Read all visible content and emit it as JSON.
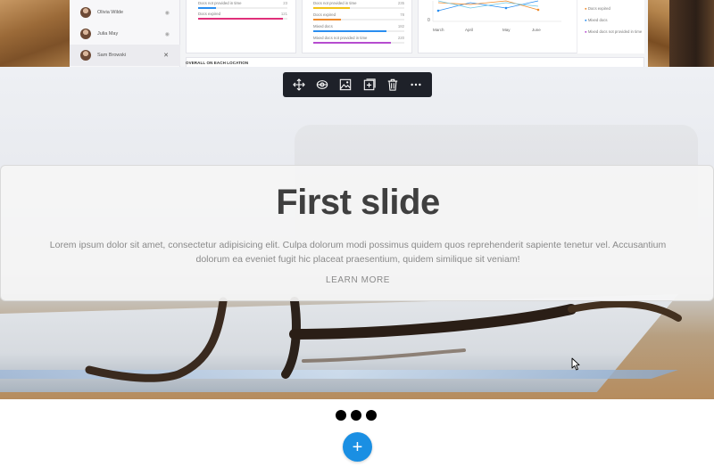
{
  "dashboard": {
    "users": [
      {
        "name": "Olivia Wilde",
        "action": "eye-icon"
      },
      {
        "name": "Julia May",
        "action": "eye-icon"
      },
      {
        "name": "Sam Browski",
        "action": "close-icon"
      }
    ],
    "card1": {
      "rows": [
        {
          "label": "Docs not provided in time",
          "value": "23",
          "fill": 0.2,
          "color": "#2a8ef0"
        },
        {
          "label": "Docs expired",
          "value": "121",
          "fill": 0.95,
          "color": "#e0307a"
        }
      ]
    },
    "card2": {
      "rows": [
        {
          "label": "Docs not provided in time",
          "value": "235",
          "fill": 0.4,
          "color": "#f2c318"
        },
        {
          "label": "Docs expired",
          "value": "78",
          "fill": 0.3,
          "color": "#f08a2a"
        },
        {
          "label": "Mixed docs",
          "value": "182",
          "fill": 0.8,
          "color": "#2a8ef0"
        },
        {
          "label": "Mixed docs not provided in time",
          "value": "220",
          "fill": 0.85,
          "color": "#b64ccf"
        }
      ]
    },
    "chart": {
      "y_tick": "0",
      "months": [
        "March",
        "April",
        "May",
        "June"
      ]
    },
    "legend": [
      {
        "label": "Docs expired",
        "color": "#f08a2a"
      },
      {
        "label": "Mixed docs",
        "color": "#2a8ef0"
      },
      {
        "label": "Mixed docs not provided in time",
        "color": "#b64ccf"
      }
    ],
    "section_title": "OVERALL ON EACH LOCATION"
  },
  "slide": {
    "title": "First slide",
    "body": "Lorem ipsum dolor sit amet, consectetur adipisicing elit. Culpa dolorum modi possimus quidem quos reprehenderit sapiente tenetur vel. Accusantium dolorum ea eveniet fugit hic placeat praesentium, quidem similique sit veniam!",
    "link": "LEARN MORE"
  },
  "toolbar": {
    "buttons": [
      "move-icon",
      "visibility-icon",
      "image-icon",
      "add-block-icon",
      "trash-icon",
      "more-icon"
    ]
  },
  "carousel": {
    "indicator_count": 3
  },
  "add_button": {
    "label": "+",
    "color": "#1a8fe3"
  }
}
